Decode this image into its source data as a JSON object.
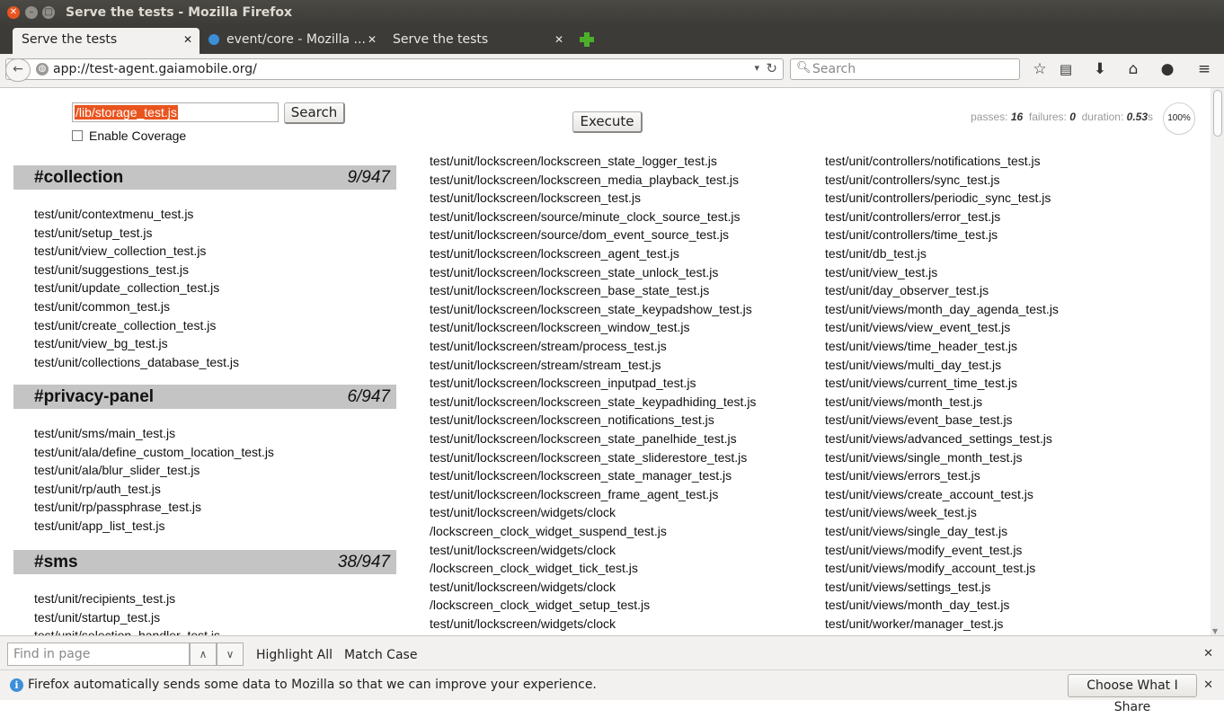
{
  "window": {
    "title": "Serve the tests - Mozilla Firefox"
  },
  "tabs": [
    {
      "label": "Serve the tests",
      "active": true
    },
    {
      "label": "event/core - Mozilla ...",
      "active": false
    },
    {
      "label": "Serve the tests",
      "active": false
    }
  ],
  "navbar": {
    "url": "app://test-agent.gaiamobile.org/",
    "search_placeholder": "Search"
  },
  "toolbar": {
    "test_input_value": "/lib/storage_test.js",
    "search_label": "Search",
    "execute_label": "Execute",
    "coverage_label": "Enable Coverage"
  },
  "stats": {
    "passes_label": "passes:",
    "passes": "16",
    "failures_label": "failures:",
    "failures": "0",
    "duration_label": "duration:",
    "duration": "0.53",
    "duration_unit": "s",
    "progress": "100%"
  },
  "groups": [
    {
      "name": "#collection",
      "count": "9/947",
      "tests": [
        "test/unit/contextmenu_test.js",
        "test/unit/setup_test.js",
        "test/unit/view_collection_test.js",
        "test/unit/suggestions_test.js",
        "test/unit/update_collection_test.js",
        "test/unit/common_test.js",
        "test/unit/create_collection_test.js",
        "test/unit/view_bg_test.js",
        "test/unit/collections_database_test.js"
      ]
    },
    {
      "name": "#privacy-panel",
      "count": "6/947",
      "tests": [
        "test/unit/sms/main_test.js",
        "test/unit/ala/define_custom_location_test.js",
        "test/unit/ala/blur_slider_test.js",
        "test/unit/rp/auth_test.js",
        "test/unit/rp/passphrase_test.js",
        "test/unit/app_list_test.js"
      ]
    },
    {
      "name": "#sms",
      "count": "38/947",
      "tests": [
        "test/unit/recipients_test.js",
        "test/unit/startup_test.js",
        "test/unit/selection_handler_test.js"
      ]
    }
  ],
  "middle_column": [
    "test/unit/lockscreen/lockscreen_state_logger_test.js",
    "test/unit/lockscreen/lockscreen_media_playback_test.js",
    "test/unit/lockscreen/lockscreen_test.js",
    "test/unit/lockscreen/source/minute_clock_source_test.js",
    "test/unit/lockscreen/source/dom_event_source_test.js",
    "test/unit/lockscreen/lockscreen_agent_test.js",
    "test/unit/lockscreen/lockscreen_state_unlock_test.js",
    "test/unit/lockscreen/lockscreen_base_state_test.js",
    "test/unit/lockscreen/lockscreen_state_keypadshow_test.js",
    "test/unit/lockscreen/lockscreen_window_test.js",
    "test/unit/lockscreen/stream/process_test.js",
    "test/unit/lockscreen/stream/stream_test.js",
    "test/unit/lockscreen/lockscreen_inputpad_test.js",
    "test/unit/lockscreen/lockscreen_state_keypadhiding_test.js",
    "test/unit/lockscreen/lockscreen_notifications_test.js",
    "test/unit/lockscreen/lockscreen_state_panelhide_test.js",
    "test/unit/lockscreen/lockscreen_state_sliderestore_test.js",
    "test/unit/lockscreen/lockscreen_state_manager_test.js",
    "test/unit/lockscreen/lockscreen_frame_agent_test.js",
    "test/unit/lockscreen/widgets/clock",
    "/lockscreen_clock_widget_suspend_test.js",
    "test/unit/lockscreen/widgets/clock",
    "/lockscreen_clock_widget_tick_test.js",
    "test/unit/lockscreen/widgets/clock",
    "/lockscreen_clock_widget_setup_test.js",
    "test/unit/lockscreen/widgets/clock"
  ],
  "right_column": [
    "test/unit/controllers/notifications_test.js",
    "test/unit/controllers/sync_test.js",
    "test/unit/controllers/periodic_sync_test.js",
    "test/unit/controllers/error_test.js",
    "test/unit/controllers/time_test.js",
    "test/unit/db_test.js",
    "test/unit/view_test.js",
    "test/unit/day_observer_test.js",
    "test/unit/views/month_day_agenda_test.js",
    "test/unit/views/view_event_test.js",
    "test/unit/views/time_header_test.js",
    "test/unit/views/multi_day_test.js",
    "test/unit/views/current_time_test.js",
    "test/unit/views/month_test.js",
    "test/unit/views/event_base_test.js",
    "test/unit/views/advanced_settings_test.js",
    "test/unit/views/single_month_test.js",
    "test/unit/views/errors_test.js",
    "test/unit/views/create_account_test.js",
    "test/unit/views/week_test.js",
    "test/unit/views/single_day_test.js",
    "test/unit/views/modify_event_test.js",
    "test/unit/views/modify_account_test.js",
    "test/unit/views/settings_test.js",
    "test/unit/views/month_day_test.js",
    "test/unit/worker/manager_test.js"
  ],
  "findbar": {
    "placeholder": "Find in page",
    "highlight_label": "Highlight All",
    "matchcase_label": "Match Case"
  },
  "notification": {
    "text": "Firefox automatically sends some data to Mozilla so that we can improve your experience.",
    "button_label": "Choose What I Share"
  },
  "icons": {
    "back": "back-arrow-icon",
    "site": "globe-icon",
    "reload": "reload-icon",
    "bookmark": "star-icon",
    "reading_list": "bookmarks-menu-icon",
    "downloads": "download-icon",
    "home": "home-icon",
    "chat": "chat-icon",
    "menu": "hamburger-menu-icon",
    "new_tab": "plus-icon",
    "info": "info-icon"
  },
  "colors": {
    "title_bar": "#3c3b37",
    "close_button": "#e95420",
    "selection": "#e9541e",
    "group_header": "#c4c4c4",
    "new_tab_plus": "#4caf2a",
    "info": "#3d8fd8"
  }
}
